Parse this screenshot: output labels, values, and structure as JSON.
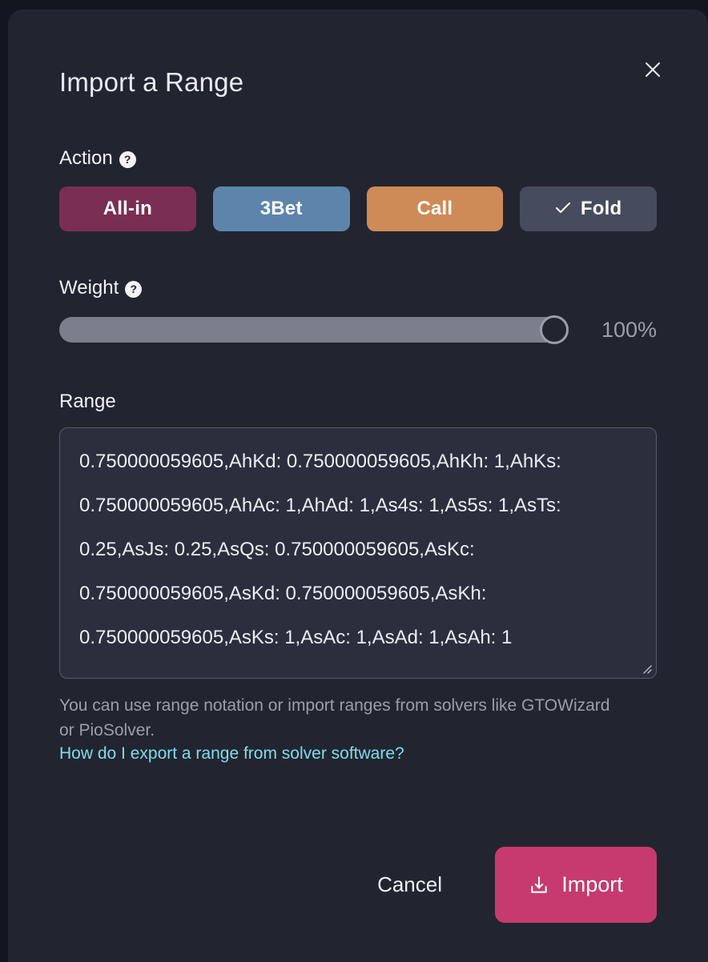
{
  "dialog": {
    "title": "Import a Range",
    "close_icon": "close-icon"
  },
  "action": {
    "label": "Action",
    "help_glyph": "?",
    "buttons": [
      {
        "label": "All-in",
        "color": "#7a2e54",
        "selected": false
      },
      {
        "label": "3Bet",
        "color": "#5d85ac",
        "selected": false
      },
      {
        "label": "Call",
        "color": "#ce8b57",
        "selected": false
      },
      {
        "label": "Fold",
        "color": "#464b5e",
        "selected": true
      }
    ]
  },
  "weight": {
    "label": "Weight",
    "help_glyph": "?",
    "value_text": "100%",
    "percent": 100
  },
  "range": {
    "label": "Range",
    "value": "0.750000059605,AhKd: 0.750000059605,AhKh: 1,AhKs: 0.750000059605,AhAc: 1,AhAd: 1,As4s: 1,As5s: 1,AsTs: 0.25,AsJs: 0.25,AsQs: 0.750000059605,AsKc: 0.750000059605,AsKd: 0.750000059605,AsKh: 0.750000059605,AsKs: 1,AsAc: 1,AsAd: 1,AsAh: 1",
    "placeholder": "Range"
  },
  "helper": {
    "text": "You can use range notation or import ranges from solvers like GTOWizard or PioSolver.",
    "link_text": "How do I export a range from solver software?"
  },
  "footer": {
    "cancel_label": "Cancel",
    "import_label": "Import"
  }
}
